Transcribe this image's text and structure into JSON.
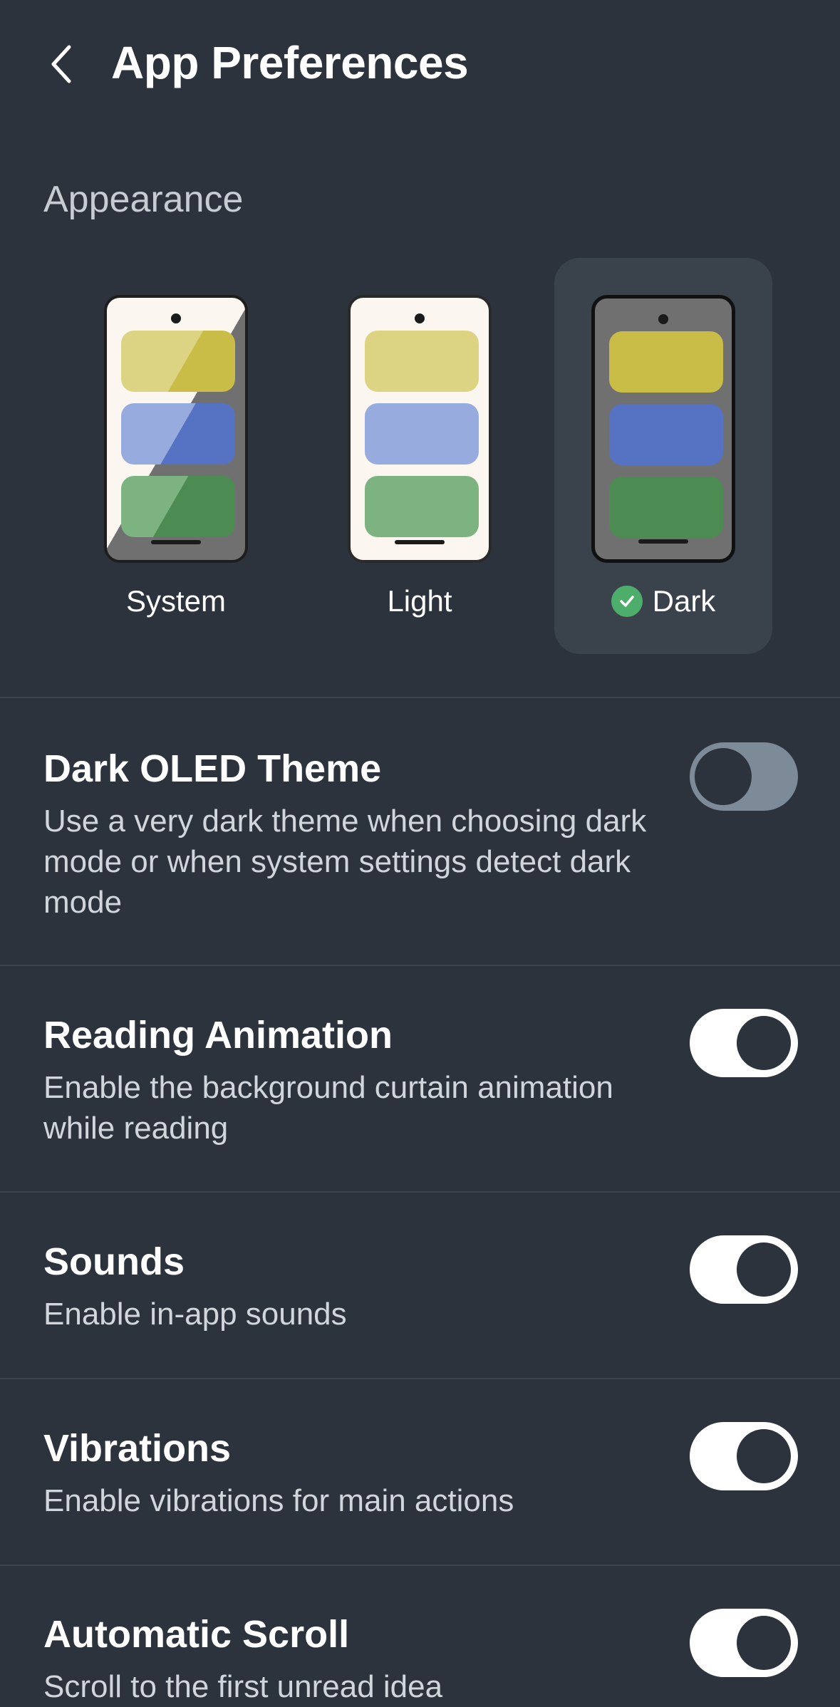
{
  "header": {
    "title": "App Preferences",
    "back_icon": "chevron-left-icon"
  },
  "appearance": {
    "section_title": "Appearance",
    "options": [
      {
        "label": "System",
        "selected": false
      },
      {
        "label": "Light",
        "selected": false
      },
      {
        "label": "Dark",
        "selected": true
      }
    ],
    "colors": {
      "selected_bg": "#3a424c",
      "check": "#4cae6a"
    }
  },
  "settings": [
    {
      "title": "Dark OLED Theme",
      "description": "Use a very dark theme when choosing dark mode or when system settings detect dark mode",
      "enabled": false
    },
    {
      "title": "Reading Animation",
      "description": "Enable the background curtain animation while reading",
      "enabled": true
    },
    {
      "title": "Sounds",
      "description": "Enable in-app sounds",
      "enabled": true
    },
    {
      "title": "Vibrations",
      "description": "Enable vibrations for main actions",
      "enabled": true
    },
    {
      "title": "Automatic Scroll",
      "description": "Scroll to the first unread idea",
      "enabled": true
    }
  ],
  "colors": {
    "background": "#2c333c",
    "toggle_on": "#ffffff",
    "toggle_off": "#7d8a98"
  }
}
